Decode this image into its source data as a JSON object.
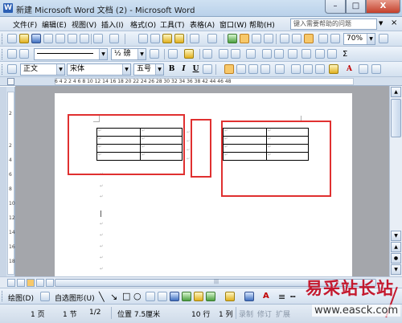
{
  "window": {
    "title": "新建 Microsoft Word 文档 (2) - Microsoft Word",
    "close_glyph": "X",
    "min_glyph": "–",
    "max_glyph": "□"
  },
  "menu": {
    "items": [
      "文件(F)",
      "编辑(E)",
      "视图(V)",
      "插入(I)",
      "格式(O)",
      "工具(T)",
      "表格(A)",
      "窗口(W)",
      "帮助(H)"
    ],
    "help_placeholder": "键入需要帮助的问题",
    "close_glyph": "×"
  },
  "toolbar": {
    "zoom": "70%",
    "line_weight": "½ 磅",
    "font_style": "正文",
    "font_name": "宋体",
    "font_size": "五号",
    "bold": "B",
    "italic": "I",
    "underline": "U",
    "font_color_glyph": "A",
    "sigma": "Σ"
  },
  "ruler": {
    "h_ticks": "6  4  2     2  4  6  8  10  12  14  16  18  20  22  24  26  28  30  32  34  36  38     42  44  46  48",
    "v_ticks": [
      "2",
      "2",
      "4",
      "6",
      "8",
      "10",
      "12",
      "14",
      "16",
      "18"
    ]
  },
  "drawbar": {
    "draw_label": "绘图(D)",
    "autoshape_label": "自选图形(U)"
  },
  "status": {
    "page": "1 页",
    "section": "1 节",
    "page_of": "1/2",
    "position": "位置 7.5厘米",
    "line": "10 行",
    "column": "1 列",
    "rec": "录制",
    "trk": "修订",
    "ext": "扩展"
  },
  "watermark": {
    "cn": "易采站长站",
    "url": "www.easck.com"
  }
}
